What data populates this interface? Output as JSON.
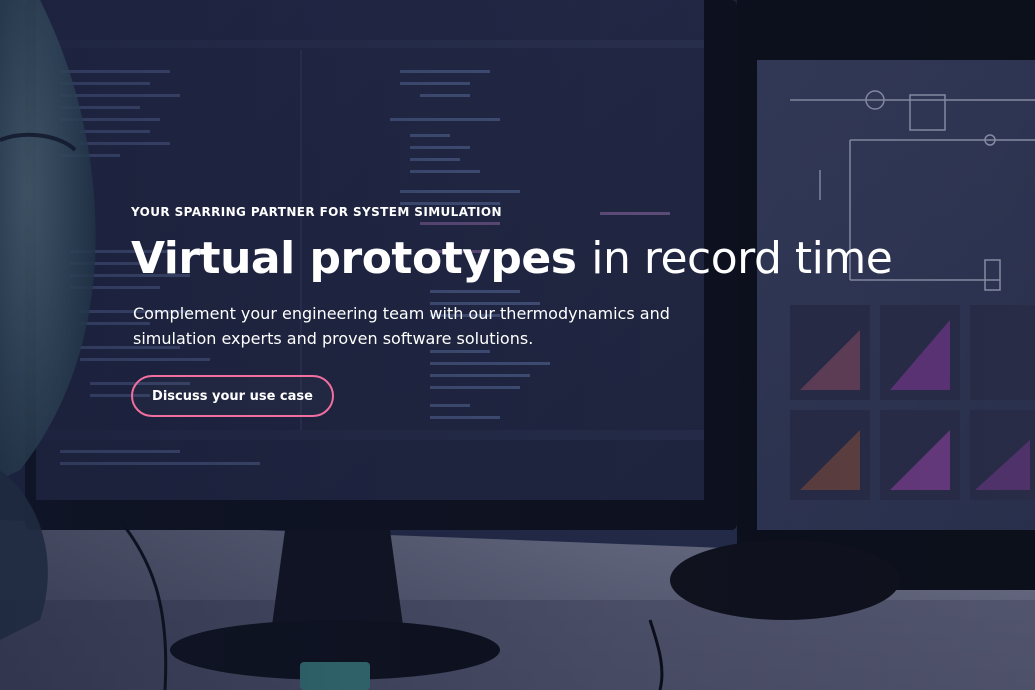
{
  "hero": {
    "eyebrow": "YOUR SPARRING PARTNER FOR SYSTEM SIMULATION",
    "headline_strong": "Virtual prototypes",
    "headline_light": "in record time",
    "lead": "Complement your engineering team with our thermodynamics and simulation experts and proven software solutions.",
    "cta_label": "Discuss your use case"
  },
  "colors": {
    "accent": "#f06fa0",
    "background": "#141a2e",
    "text": "#ffffff"
  }
}
